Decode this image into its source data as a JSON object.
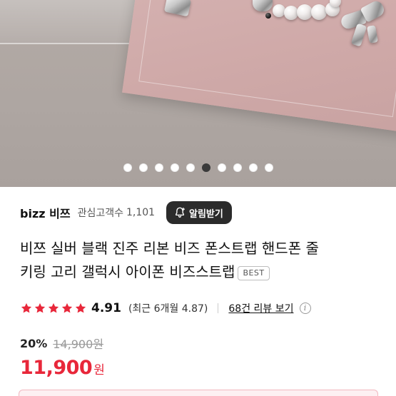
{
  "gallery": {
    "total_images": 10,
    "active_index": 6
  },
  "seller": {
    "name": "bizz 비쯔",
    "fans_label": "관심고객수",
    "fans_count": "1,101",
    "alarm_button_label": "알림받기"
  },
  "product": {
    "title_line1": "비쯔 실버 블랙 진주 리본 비즈 폰스트랩 핸드폰 줄",
    "title_line2": "키링 고리 갤럭시 아이폰 비즈스트랩",
    "badge": "BEST"
  },
  "rating": {
    "stars": 5,
    "score": "4.91",
    "recent": "(최근 6개월 4.87)",
    "review_link": "68건 리뷰 보기",
    "info_icon": "info-icon"
  },
  "price": {
    "discount": "20%",
    "original": "14,900원",
    "current_amount": "11,900",
    "current_unit": "원"
  },
  "colors": {
    "accent": "#e8273a",
    "star": "#e8273a",
    "button_bg": "#2b2b2b"
  }
}
